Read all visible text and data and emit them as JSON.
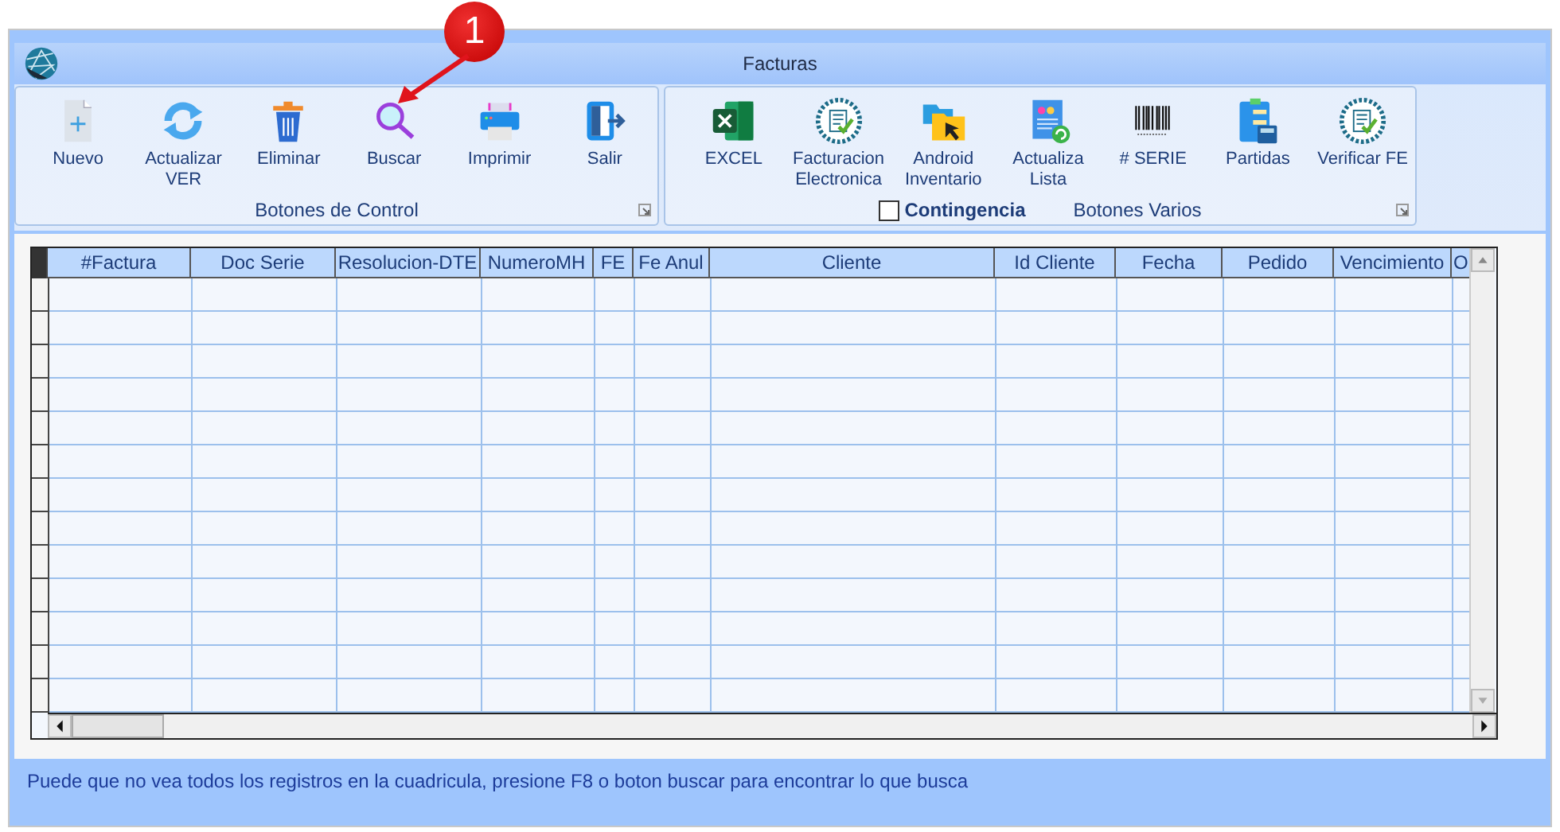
{
  "window": {
    "title": "Facturas"
  },
  "ribbon_groups": [
    {
      "label": "Botones de Control",
      "buttons": [
        {
          "label": "Nuevo",
          "kind": "new"
        },
        {
          "label": "Actualizar VER",
          "kind": "refresh"
        },
        {
          "label": "Eliminar",
          "kind": "delete"
        },
        {
          "label": "Buscar",
          "kind": "search"
        },
        {
          "label": "Imprimir",
          "kind": "print"
        },
        {
          "label": "Salir",
          "kind": "exit"
        }
      ]
    },
    {
      "label": "Botones Varios",
      "buttons": [
        {
          "label": "EXCEL",
          "kind": "excel"
        },
        {
          "label": "Facturacion Electronica",
          "kind": "seal"
        },
        {
          "label": "Android Inventario",
          "kind": "folder"
        },
        {
          "label": "Actualiza Lista",
          "kind": "list"
        },
        {
          "label": "# SERIE",
          "kind": "barcode"
        },
        {
          "label": "Partidas",
          "kind": "calc"
        },
        {
          "label": "Verificar FE",
          "kind": "seal"
        }
      ],
      "checkbox": {
        "label": "Contingencia",
        "checked": false
      }
    }
  ],
  "table": {
    "columns": [
      "#Factura",
      "Doc Serie",
      "Resolucion-DTE",
      "NumeroMH",
      "FE",
      "Fe Anul",
      "Cliente",
      "Id Cliente",
      "Fecha",
      "Pedido",
      "Vencimiento",
      "O"
    ]
  },
  "status_text": "Puede que no vea todos los registros en la cuadricula, presione F8 o boton buscar para encontrar lo que busca",
  "annotation": {
    "number": "1"
  }
}
